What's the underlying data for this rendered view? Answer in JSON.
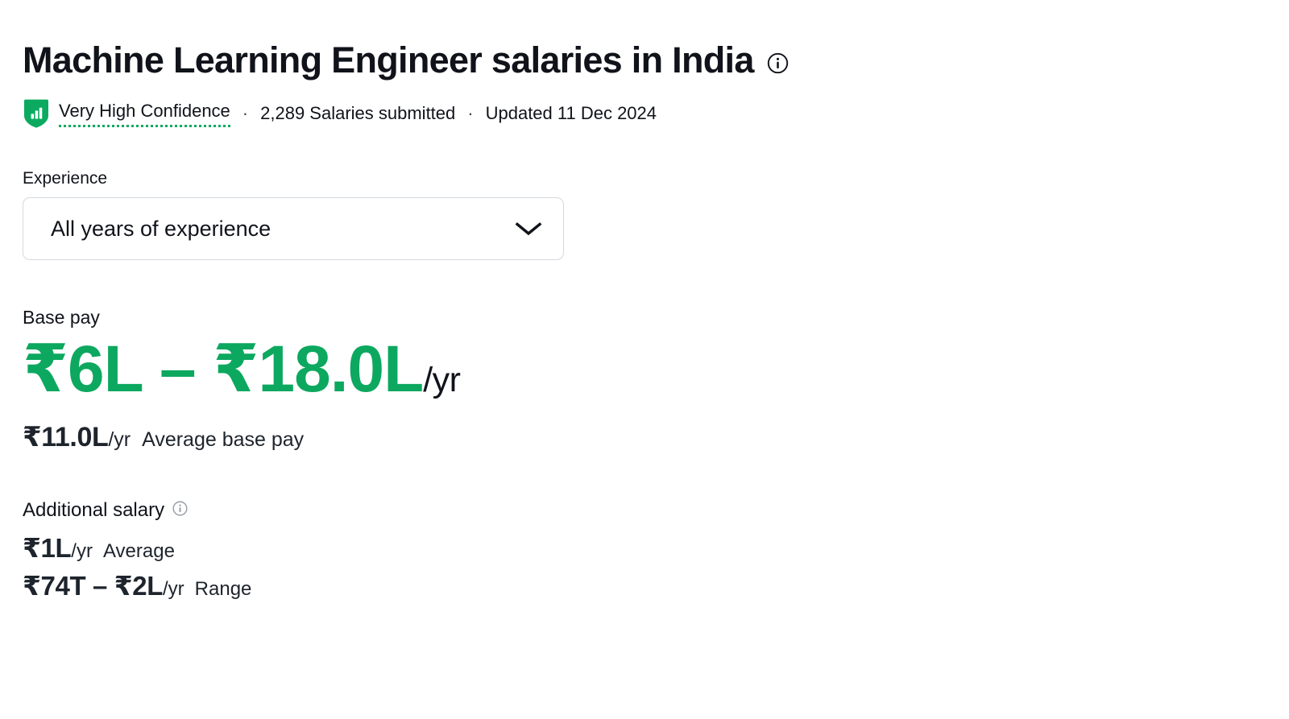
{
  "header": {
    "title": "Machine Learning Engineer salaries in India",
    "info_icon": "info-circle-icon"
  },
  "meta": {
    "confidence_badge_icon": "bar-chart-shield-icon",
    "confidence_label": "Very High Confidence",
    "separator": "·",
    "salaries_submitted": "2,289 Salaries submitted",
    "updated": "Updated 11 Dec 2024"
  },
  "experience": {
    "label": "Experience",
    "selected": "All years of experience",
    "chevron_icon": "chevron-down-icon",
    "options": [
      "All years of experience"
    ]
  },
  "base_pay": {
    "label": "Base pay",
    "range_amount": "₹6L – ₹18.0L",
    "range_period": "/yr",
    "average_amount": "₹11.0L",
    "average_period": "/yr",
    "average_desc": "Average base pay"
  },
  "additional_salary": {
    "label": "Additional salary",
    "info_icon": "info-circle-icon",
    "average_amount": "₹1L",
    "average_period": "/yr",
    "average_desc": "Average",
    "range_amount": "₹74T – ₹2L",
    "range_period": "/yr",
    "range_desc": "Range"
  },
  "colors": {
    "accent_green": "#0ca85f",
    "badge_green": "#0caa60",
    "text_dark": "#10131a",
    "border_gray": "#d4d8dd",
    "icon_gray": "#9aa0a8"
  }
}
